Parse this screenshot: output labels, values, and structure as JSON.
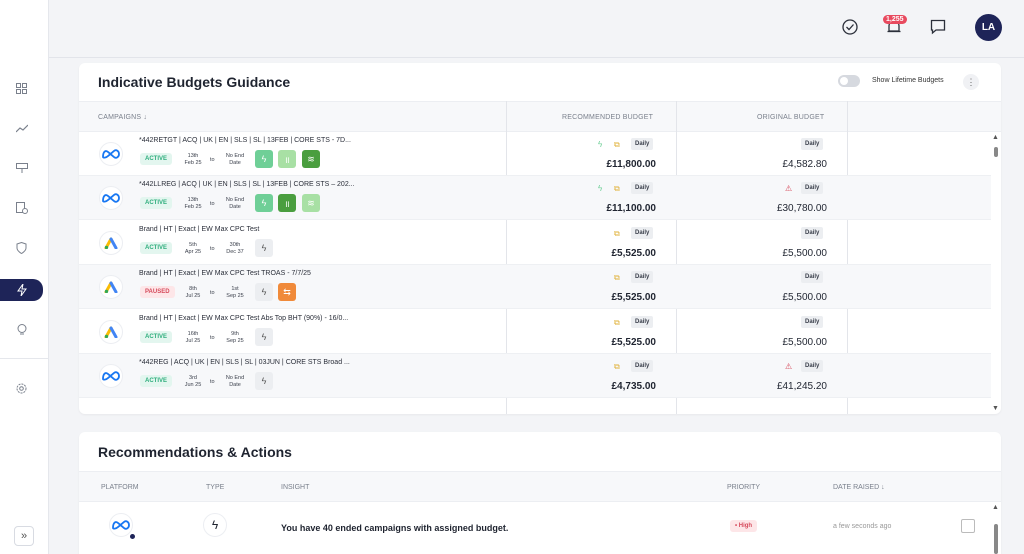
{
  "topbar": {
    "notifications_count": "1,255",
    "avatar_initials": "LA"
  },
  "budgets": {
    "title": "Indicative Budgets Guidance",
    "toggle_label": "Show Lifetime Budgets",
    "columns": {
      "campaigns": "CAMPAIGNS ↓",
      "recommended": "RECOMMENDED BUDGET",
      "original": "ORIGINAL BUDGET"
    },
    "rows": [
      {
        "platform": "meta",
        "name": "*442RETGT | ACQ | UK | EN | SLS | SL | 13FEB | CORE STS - 7D...",
        "status": "ACTIVE",
        "start": [
          "13th",
          "Feb 25"
        ],
        "to": "to",
        "end": [
          "No End",
          "Date"
        ],
        "rec_period": "Daily",
        "rec_amount": "£11,800.00",
        "orig_period": "Daily",
        "orig_amount": "£4,582.80"
      },
      {
        "platform": "meta",
        "name": "*442LLREG | ACQ | UK | EN | SLS | SL | 13FEB | CORE STS – 202...",
        "status": "ACTIVE",
        "start": [
          "13th",
          "Feb 25"
        ],
        "to": "to",
        "end": [
          "No End",
          "Date"
        ],
        "rec_period": "Daily",
        "rec_amount": "£11,100.00",
        "orig_period": "Daily",
        "orig_amount": "£30,780.00"
      },
      {
        "platform": "google",
        "name": "Brand | HT | Exact | EW Max CPC Test",
        "status": "ACTIVE",
        "start": [
          "5th",
          "Apr 25"
        ],
        "to": "to",
        "end": [
          "30th",
          "Dec 37"
        ],
        "rec_period": "Daily",
        "rec_amount": "£5,525.00",
        "orig_period": "Daily",
        "orig_amount": "£5,500.00"
      },
      {
        "platform": "google",
        "name": "Brand | HT | Exact | EW Max CPC Test TROAS - 7/7/25",
        "status": "PAUSED",
        "start": [
          "8th",
          "Jul 25"
        ],
        "to": "to",
        "end": [
          "1st",
          "Sep 25"
        ],
        "rec_period": "Daily",
        "rec_amount": "£5,525.00",
        "orig_period": "Daily",
        "orig_amount": "£5,500.00"
      },
      {
        "platform": "google",
        "name": "Brand | HT | Exact | EW Max CPC Test Abs Top BHT (90%) - 16/0...",
        "status": "ACTIVE",
        "start": [
          "16th",
          "Jul 25"
        ],
        "to": "to",
        "end": [
          "9th",
          "Sep 25"
        ],
        "rec_period": "Daily",
        "rec_amount": "£5,525.00",
        "orig_period": "Daily",
        "orig_amount": "£5,500.00"
      },
      {
        "platform": "meta",
        "name": "*442REG | ACQ | UK | EN | SLS | SL | 03JUN | CORE STS Broad ...",
        "status": "ACTIVE",
        "start": [
          "3rd",
          "Jun 25"
        ],
        "to": "to",
        "end": [
          "No End",
          "Date"
        ],
        "rec_period": "Daily",
        "rec_amount": "£4,735.00",
        "orig_period": "Daily",
        "orig_amount": "£41,245.20"
      }
    ]
  },
  "recommendations": {
    "title": "Recommendations & Actions",
    "columns": {
      "platform": "PLATFORM",
      "type": "TYPE",
      "insight": "INSIGHT",
      "priority": "PRIORITY",
      "date_raised": "DATE RAISED ↓"
    },
    "row": {
      "insight": "You have 40 ended campaigns with assigned budget.",
      "priority": "• High",
      "date_raised": "a few seconds ago"
    }
  },
  "colors": {
    "accent": "#1e2458",
    "active": "#2fae7d",
    "paused": "#d64b5c",
    "meta": "#1877f2"
  }
}
